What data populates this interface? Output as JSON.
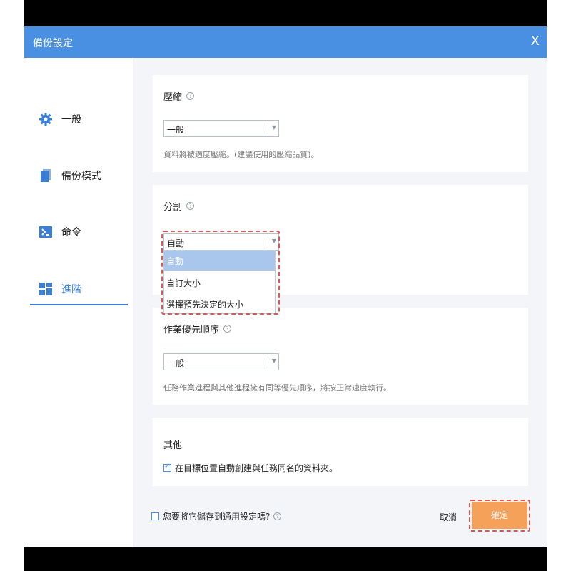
{
  "window": {
    "title": "備份設定",
    "close_label": "X"
  },
  "sidebar": {
    "items": [
      {
        "label": "一般",
        "icon": "gear-icon"
      },
      {
        "label": "備份模式",
        "icon": "document-icon"
      },
      {
        "label": "命令",
        "icon": "terminal-icon"
      },
      {
        "label": "進階",
        "icon": "grid-icon"
      }
    ],
    "active_index": 3
  },
  "sections": {
    "compression": {
      "title": "壓縮",
      "help": "?",
      "value": "一般",
      "description": "資料將被適度壓縮。(建議使用的壓縮品質)。"
    },
    "split": {
      "title": "分割",
      "help": "?",
      "value": "自動",
      "options": [
        "自動",
        "自訂大小",
        "選擇預先決定的大小"
      ],
      "selected_option": 0
    },
    "priority": {
      "title": "作業優先順序",
      "help": "?",
      "value": "一般",
      "description": "任務作業進程與其他進程擁有同等優先順序，將按正常速度執行。"
    },
    "other": {
      "title": "其他",
      "checkbox_label": "在目標位置自動創建與任務同名的資料夾。",
      "checked": true
    }
  },
  "footer": {
    "save_default_label": "您要將它儲存到通用設定嗎?",
    "help": "?",
    "cancel_label": "取消",
    "ok_label": "確定"
  },
  "colors": {
    "titlebar": "#4a90e2",
    "accent": "#3a7fd5",
    "ok_button": "#f5a15a",
    "highlight": "#e05656",
    "dropdown_selected": "#a9c7ec"
  }
}
